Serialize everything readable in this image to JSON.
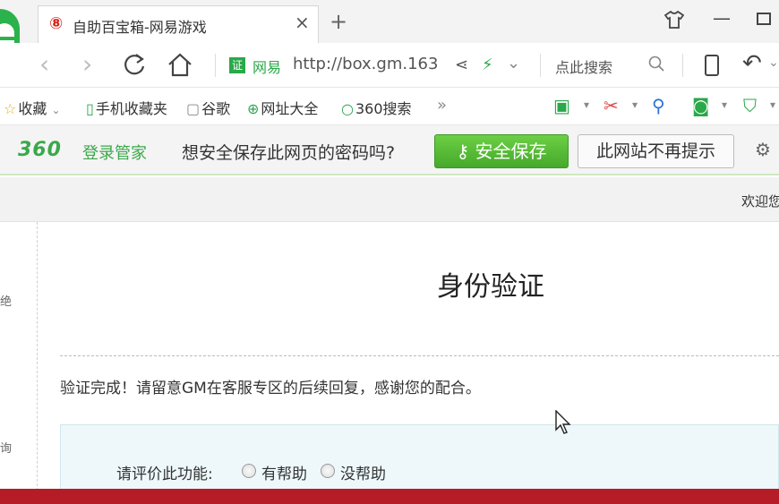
{
  "tab": {
    "title": "自助百宝箱-网易游戏",
    "close": "×",
    "new_tab": "+"
  },
  "window": {
    "minimize": "—"
  },
  "nav": {
    "back": "‹",
    "forward": "›",
    "cert_badge": "证",
    "cert_label": "网易",
    "url": "http://box.gm.163",
    "dropdown": "⌄",
    "search_placeholder": "点此搜索",
    "undo": "↶",
    "undo_dd": "⌄"
  },
  "bookmarks": {
    "items": [
      "收藏",
      "手机收藏夹",
      "谷歌",
      "网址大全",
      "360搜索"
    ],
    "favorites_dd": "⌄",
    "more": "»"
  },
  "password_bar": {
    "brand": "360",
    "brand_sub": "登录管家",
    "question": "想安全保存此网页的密码吗?",
    "save_label": "安全保存",
    "never_label": "此网站不再提示"
  },
  "page": {
    "welcome": "欢迎您",
    "title": "身份验证",
    "message": "验证完成！请留意GM在客服专区的后续回复，感谢您的配合。",
    "feedback_label": "请评价此功能:",
    "option_helpful": "有帮助",
    "option_not_helpful": "没帮助",
    "left_fragments": [
      "绝",
      "询"
    ]
  },
  "colors": {
    "accent_green": "#3aa84a",
    "save_button": "#46a92b",
    "bottom_band": "#b51c25",
    "feedback_bg": "#eef8fb"
  }
}
